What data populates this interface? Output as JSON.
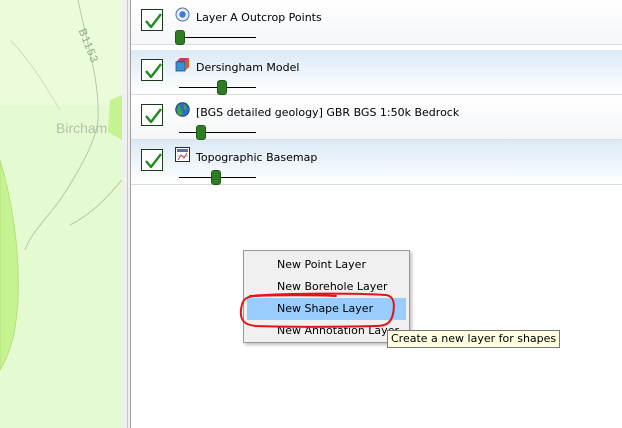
{
  "map": {
    "place_label": "Bircham",
    "road_label": "B1153"
  },
  "layers": [
    {
      "name": "Layer A Outcrop Points",
      "icon": "point-layer-icon",
      "checked": true,
      "opacity": 0.0
    },
    {
      "name": "Dersingham Model",
      "icon": "model-layer-icon",
      "checked": true,
      "opacity": 0.55
    },
    {
      "name": "[BGS detailed geology] GBR BGS 1:50k Bedrock",
      "icon": "globe-layer-icon",
      "checked": true,
      "opacity": 0.25
    },
    {
      "name": "Topographic Basemap",
      "icon": "basemap-layer-icon",
      "checked": true,
      "opacity": 0.45
    }
  ],
  "context_menu": {
    "items": [
      {
        "label": "New Point Layer",
        "highlighted": false
      },
      {
        "label": "New Borehole Layer",
        "highlighted": false
      },
      {
        "label": "New Shape Layer",
        "highlighted": true
      },
      {
        "label": "New Annotation Layer",
        "highlighted": false
      }
    ]
  },
  "tooltip": {
    "text": "Create a new layer for shapes"
  },
  "colors": {
    "map_background": "#e4fad0",
    "map_feature": "#c6f391",
    "slider_thumb": "#2e7d22",
    "checkmark": "#1f8a1f",
    "menu_highlight": "#99ccff",
    "annotation_red": "#e0141a"
  }
}
